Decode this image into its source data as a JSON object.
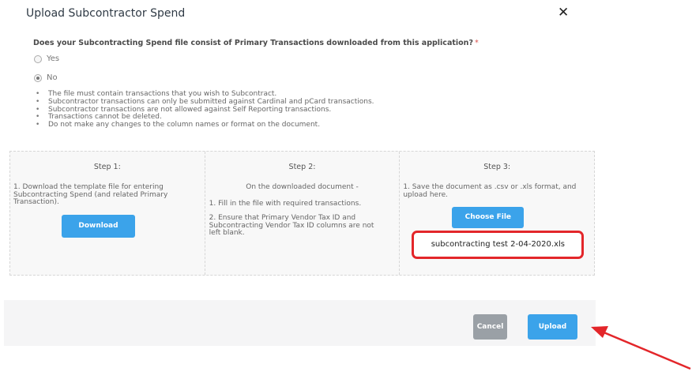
{
  "dialog": {
    "title": "Upload Subcontractor Spend",
    "close_symbol": "✕"
  },
  "question": {
    "text": "Does your Subcontracting Spend file consist of Primary Transactions downloaded from this application?",
    "required_mark": "*",
    "options": [
      {
        "label": "Yes",
        "selected": false
      },
      {
        "label": "No",
        "selected": true
      }
    ]
  },
  "notes": [
    "The file must contain transactions that you wish to Subcontract.",
    "Subcontractor transactions can only be submitted against Cardinal and pCard transactions.",
    "Subcontractor transactions are not allowed against Self Reporting transactions.",
    "Transactions cannot be deleted.",
    "Do not make any changes to the column names or format on the document."
  ],
  "steps": {
    "step1": {
      "heading": "Step 1:",
      "text": "1. Download the template file for entering Subcontracting Spend (and related Primary Transaction).",
      "button": "Download"
    },
    "step2": {
      "heading": "Step 2:",
      "subheading": "On the downloaded document -",
      "item1": "1. Fill in the file with required transactions.",
      "item2": "2. Ensure that Primary Vendor Tax ID and Subcontracting Vendor Tax ID columns are not left blank."
    },
    "step3": {
      "heading": "Step 3:",
      "text": "1. Save the document as .csv or .xls format, and upload here.",
      "button": "Choose File",
      "selected_file": "subcontracting test 2-04-2020.xls"
    }
  },
  "footer": {
    "cancel_label": "Cancel",
    "upload_label": "Upload"
  },
  "colors": {
    "accent": "#3ba3ea",
    "highlight": "#e3262a",
    "cancel": "#9aa0a6"
  }
}
